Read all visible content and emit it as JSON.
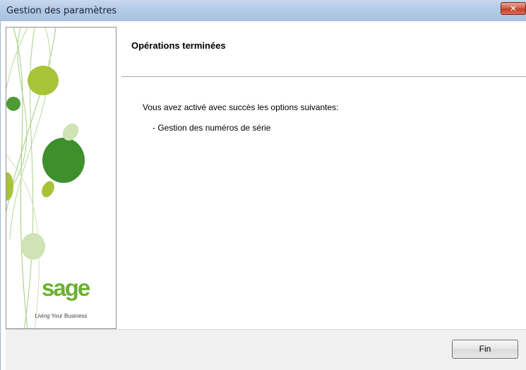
{
  "window": {
    "title": "Gestion des paramètres",
    "close_symbol": "✕",
    "close_icon": "close-icon"
  },
  "sidebar": {
    "logo_text": "sage",
    "tagline": "Living Your Business",
    "colors": {
      "dark_green": "#3f8f2f",
      "lime": "#a7c439",
      "pale_green": "#cfe3b4",
      "line": "#9ccb7a"
    }
  },
  "header": {
    "title": "Opérations terminées"
  },
  "content": {
    "message": "Vous avez activé avec succès les options suivantes:",
    "options": [
      "- Gestion des numéros de série"
    ]
  },
  "footer": {
    "finish_label": "Fin"
  }
}
